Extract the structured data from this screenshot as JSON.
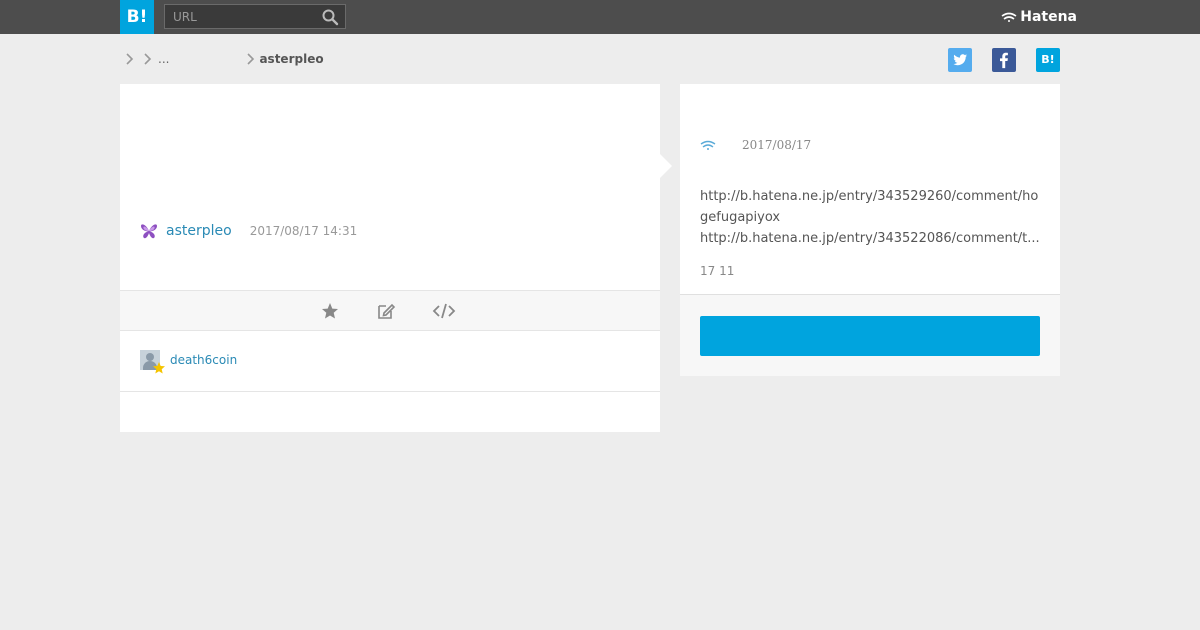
{
  "header": {
    "logo_text": "B!",
    "search_placeholder": "URL",
    "brand": "Hatena"
  },
  "breadcrumb": {
    "ellipsis": "...",
    "user": "asterpleo"
  },
  "share": {
    "twitter_label": "",
    "facebook_label": "",
    "hatena_label": "B!"
  },
  "entry": {
    "author": "asterpleo",
    "datetime": "2017/08/17 14:31"
  },
  "stars": [
    {
      "user": "death6coin",
      "star_color": "#f5c400"
    }
  ],
  "side": {
    "date": "2017/08/17",
    "url_1": "http://b.hatena.ne.jp/entry/343529260/comment/hogefugapiyox",
    "url_2": "http://b.hatena.ne.jp/entry/343522086/comment/t...",
    "counts": "17 11",
    "button_label": ""
  },
  "colors": {
    "accent": "#00a4de",
    "topbar": "#4d4d4d",
    "link": "#2a8ab5",
    "twitter": "#55acee",
    "facebook": "#3b5998"
  }
}
